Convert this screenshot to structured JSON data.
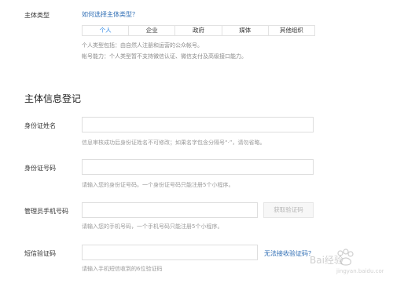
{
  "entity_type": {
    "label": "主体类型",
    "help_link": "如何选择主体类型？",
    "tabs": [
      "个人",
      "企业",
      "政府",
      "媒体",
      "其他组织"
    ],
    "desc_line1": "个人类型包括：由自然人注册和运营的公众帐号。",
    "desc_line2": "帐号能力：个人类型暂不支持微信认证、微信支付及高级接口能力。"
  },
  "section": {
    "title": "主体信息登记"
  },
  "form": {
    "id_name": {
      "label": "身份证姓名",
      "value": "",
      "hint": "信息审核成功后身份证姓名不可修改；如果名字包含分隔号“·”，请勿省略。"
    },
    "id_number": {
      "label": "身份证号码",
      "value": "",
      "hint": "请输入您的身份证号码。一个身份证号码只能注册5个小程序。"
    },
    "phone": {
      "label": "管理员手机号码",
      "value": "",
      "button": "获取验证码",
      "hint": "请输入您的手机号码，一个手机号码只能注册5个小程序。"
    },
    "sms_code": {
      "label": "短信验证码",
      "value": "",
      "help_link": "无法接收验证码？",
      "hint": "请输入手机短信收到的6位验证码"
    }
  },
  "watermark": {
    "text": "Bai经验",
    "url_text": "jingyan.baidu.com"
  }
}
